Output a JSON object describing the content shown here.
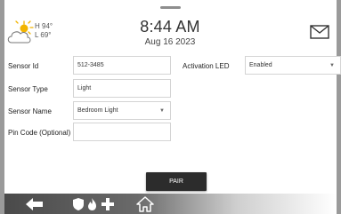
{
  "header": {
    "weather": {
      "high": "H 94°",
      "low": "L 69°",
      "icon": "partly-sunny-icon"
    },
    "time": "8:44 AM",
    "date": "Aug 16 2023",
    "messages_icon": "envelope-icon"
  },
  "form": {
    "sensor_id": {
      "label": "Sensor Id",
      "value": "512-3485"
    },
    "sensor_type": {
      "label": "Sensor Type",
      "value": "Light"
    },
    "sensor_name": {
      "label": "Sensor Name",
      "value": "Bedroom Light"
    },
    "pin_code": {
      "label": "Pin Code (Optional)",
      "value": ""
    },
    "activation_led": {
      "label": "Activation LED",
      "value": "Enabled"
    }
  },
  "pair_button": "PAIR",
  "bottom_nav": {
    "icons": [
      "back-arrow-icon",
      "shield-icon",
      "fire-icon",
      "medical-cross-icon",
      "home-icon"
    ]
  },
  "colors": {
    "sun": "#f2b400",
    "button": "#2c2c2c",
    "border": "#9a9a9a"
  }
}
